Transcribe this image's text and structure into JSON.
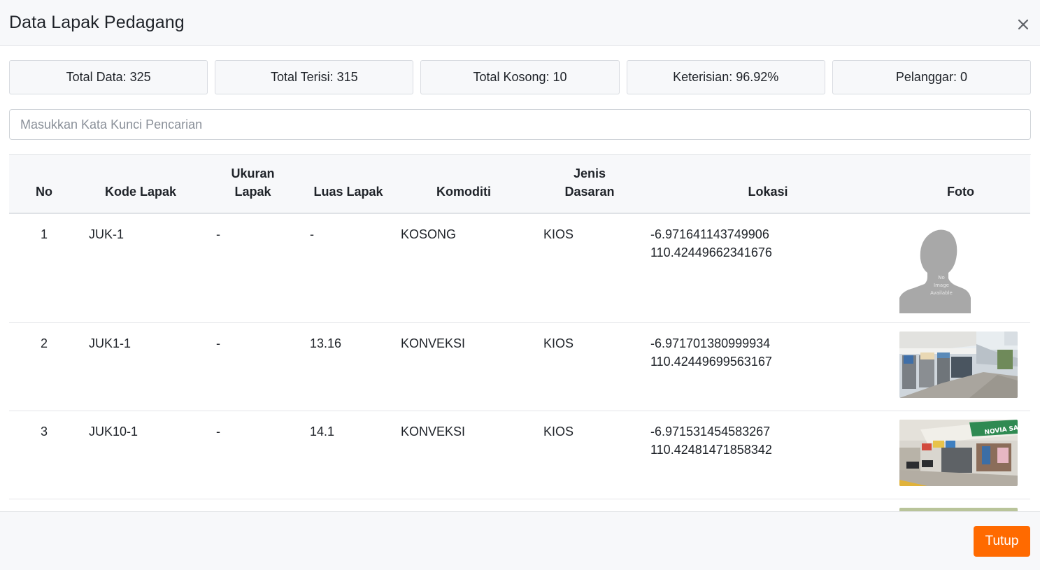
{
  "modal": {
    "title": "Data Lapak Pedagang",
    "close_label": "Tutup"
  },
  "stats": [
    "Total Data: 325",
    "Total Terisi: 315",
    "Total Kosong: 10",
    "Keterisian: 96.92%",
    "Pelanggar: 0"
  ],
  "search": {
    "placeholder": "Masukkan Kata Kunci Pencarian",
    "value": ""
  },
  "table": {
    "headers": {
      "no": "No",
      "kode": "Kode Lapak",
      "ukuran_1": "Ukuran",
      "ukuran_2": "Lapak",
      "luas": "Luas Lapak",
      "komoditi": "Komoditi",
      "jenis_1": "Jenis",
      "jenis_2": "Dasaran",
      "lokasi": "Lokasi",
      "foto": "Foto"
    },
    "rows": [
      {
        "no": "1",
        "kode": "JUK-1",
        "ukuran": "-",
        "luas": "-",
        "komoditi": "KOSONG",
        "jenis": "KIOS",
        "lat": "-6.971641143749906",
        "lng": "110.42449662341676",
        "foto_text_1": "No",
        "foto_text_2": "Image",
        "foto_text_3": "Available"
      },
      {
        "no": "2",
        "kode": "JUK1-1",
        "ukuran": "-",
        "luas": "13.16",
        "komoditi": "KONVEKSI",
        "jenis": "KIOS",
        "lat": "-6.971701380999934",
        "lng": "110.42449699563167"
      },
      {
        "no": "3",
        "kode": "JUK10-1",
        "ukuran": "-",
        "luas": "14.1",
        "komoditi": "KONVEKSI",
        "jenis": "KIOS",
        "lat": "-6.971531454583267",
        "lng": "110.42481471858342",
        "sign_text": "NOVIA SARI"
      }
    ]
  },
  "colors": {
    "accent": "#ff6a00",
    "header_bg": "#f7f8fa",
    "border": "#e3e5e8"
  },
  "icons": {
    "close": "close-icon"
  }
}
